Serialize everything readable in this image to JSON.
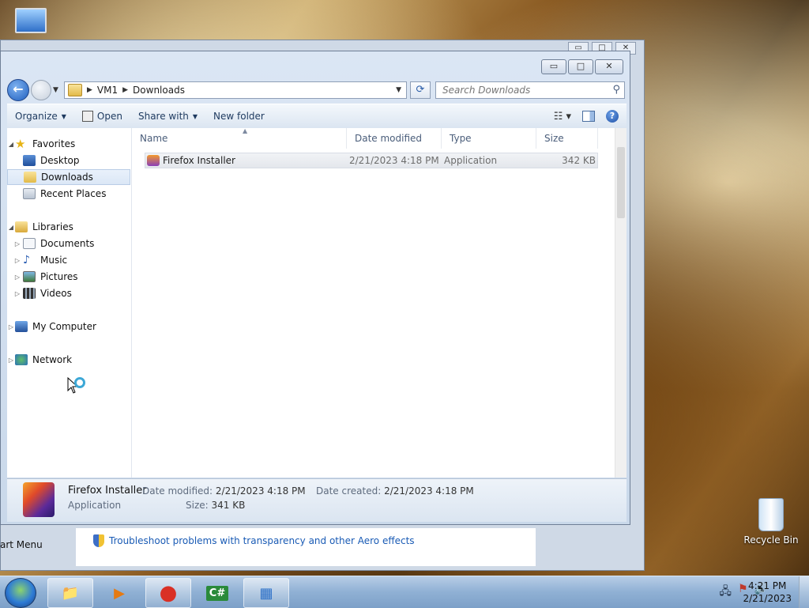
{
  "desktop": {
    "recycle_bin_label": "Recycle Bin",
    "partial_start_menu_text": "art Menu"
  },
  "background_window": {
    "min": "▭",
    "max": "□",
    "close": "✕",
    "link_text": "Troubleshoot problems with transparency and other Aero effects"
  },
  "explorer": {
    "caption": {
      "min": "▭",
      "max": "□",
      "close": "✕"
    },
    "nav": {
      "back_glyph": "←",
      "path": [
        "VM1",
        "Downloads"
      ],
      "search_placeholder": "Search Downloads"
    },
    "toolbar": {
      "organize": "Organize",
      "open": "Open",
      "share_with": "Share with",
      "new_folder": "New folder"
    },
    "sidebar": {
      "favorites": "Favorites",
      "desktop": "Desktop",
      "downloads": "Downloads",
      "recent_places": "Recent Places",
      "libraries": "Libraries",
      "documents": "Documents",
      "music": "Music",
      "pictures": "Pictures",
      "videos": "Videos",
      "my_computer": "My Computer",
      "network": "Network"
    },
    "columns": {
      "name": "Name",
      "date_modified": "Date modified",
      "type": "Type",
      "size": "Size"
    },
    "files": [
      {
        "name": "Firefox Installer",
        "date_modified": "2/21/2023 4:18 PM",
        "type": "Application",
        "size": "342 KB"
      }
    ],
    "details": {
      "name": "Firefox Installer",
      "type": "Application",
      "date_modified_label": "Date modified:",
      "date_modified": "2/21/2023 4:18 PM",
      "date_created_label": "Date created:",
      "date_created": "2/21/2023 4:18 PM",
      "size_label": "Size:",
      "size": "341 KB"
    }
  },
  "taskbar": {
    "time": "4:21 PM",
    "date": "2/21/2023",
    "app_glyphs": {
      "explorer": "📁",
      "media": "▶",
      "chrome": "●",
      "csharp": "C#",
      "remote": "▦"
    }
  }
}
